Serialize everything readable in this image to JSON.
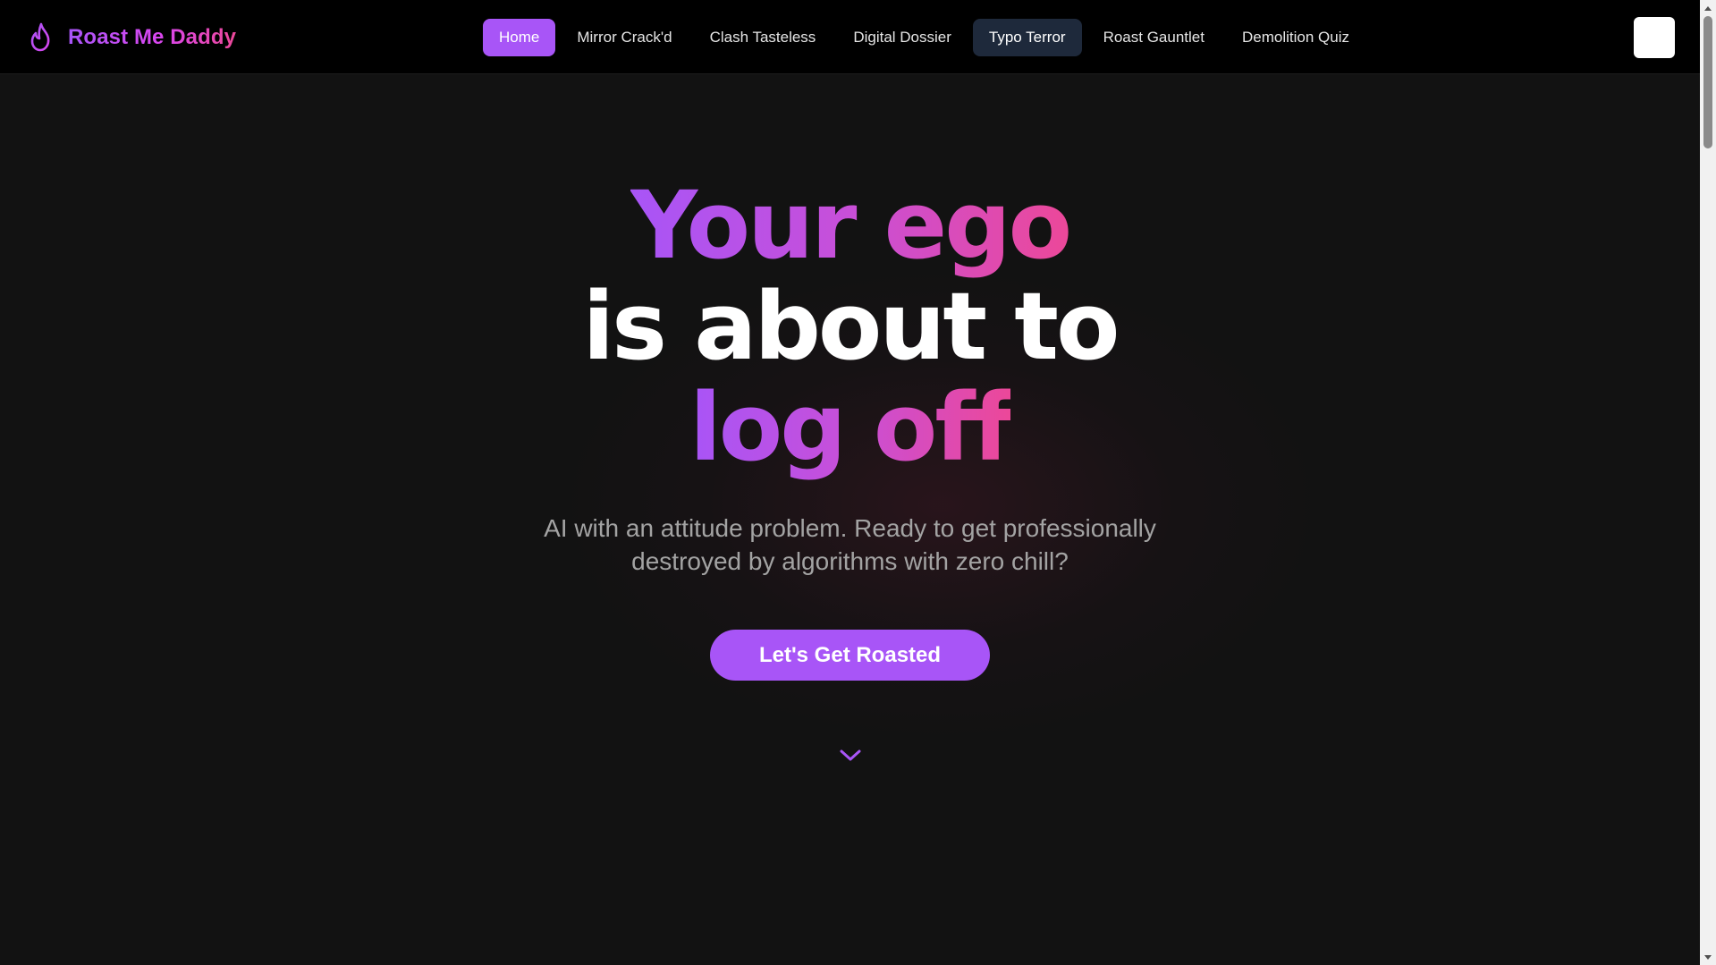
{
  "brand": {
    "name": "Roast Me Daddy",
    "icon": "flame-icon"
  },
  "nav": {
    "items": [
      {
        "label": "Home",
        "state": "active"
      },
      {
        "label": "Mirror Crack'd"
      },
      {
        "label": "Clash Tasteless"
      },
      {
        "label": "Digital Dossier"
      },
      {
        "label": "Typo Terror",
        "state": "hover"
      },
      {
        "label": "Roast Gauntlet"
      },
      {
        "label": "Demolition Quiz"
      }
    ],
    "menu_button_icon": "menu-icon"
  },
  "hero": {
    "line1": "Your ego",
    "line2": "is about to",
    "line3": "log off",
    "subtitle": "AI with an attitude problem. Ready to get professionally destroyed by algorithms with zero chill?",
    "cta_label": "Let's Get Roasted",
    "scroll_icon": "chevron-down-icon"
  },
  "colors": {
    "accent": "#a855f7",
    "accent_pink": "#ec4899",
    "background": "#121212",
    "navbar": "#000000",
    "hover_tab": "#1e293b"
  }
}
